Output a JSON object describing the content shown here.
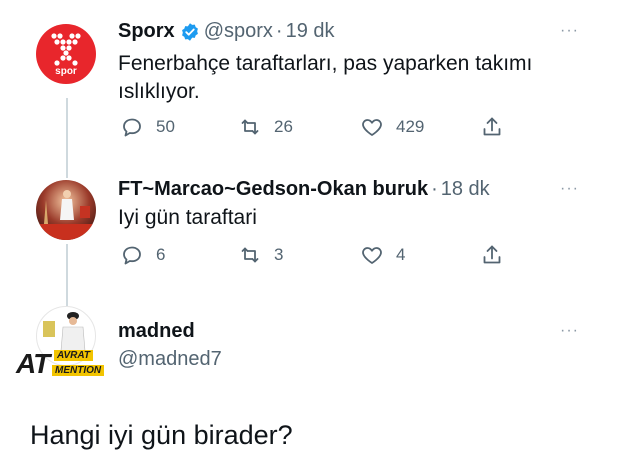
{
  "tweets": [
    {
      "name": "Sporx",
      "handle": "@sporx",
      "separator": "·",
      "time": "19 dk",
      "verified": true,
      "avatar_text": "spor",
      "text_lines": [
        "Fenerbahçe taraftarları, pas yaparken takımı",
        "ıslıklıyor."
      ],
      "replies": "50",
      "retweets": "26",
      "likes": "429",
      "more": "···"
    },
    {
      "name": "FT~Marcao~Gedson-Okan buruk",
      "separator": "·",
      "time": "18 dk",
      "text_lines": [
        "Iyi gün taraftari"
      ],
      "replies": "6",
      "retweets": "3",
      "likes": "4",
      "more": "···"
    }
  ],
  "reply": {
    "name": "madned",
    "handle": "@madned7",
    "avatar_badge_top": "AVRAT",
    "avatar_badge_big": "AT",
    "avatar_badge_bottom": "MENTION",
    "more": "···",
    "text": "Hangi iyi gün birader?"
  },
  "colors": {
    "sporx_red": "#e8262c",
    "verified_blue": "#1d9bf0",
    "muted": "#536471",
    "thread_line": "#cfd9de"
  },
  "icons": [
    "reply-icon",
    "retweet-icon",
    "like-icon",
    "share-icon",
    "verified-icon",
    "more-icon"
  ]
}
